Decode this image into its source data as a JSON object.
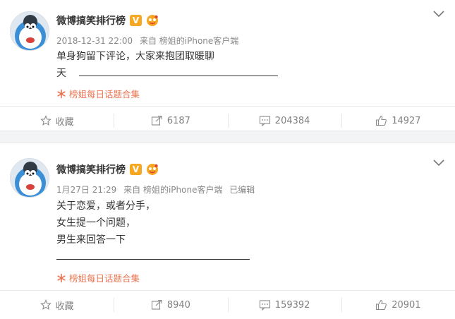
{
  "posts": [
    {
      "author": "微博搞笑排行榜",
      "verified": "V",
      "time": "2018-12-31 22:00",
      "source": "来自 榜姐的iPhone客户端",
      "edited": "",
      "content_lines": [
        "单身狗留下评论，大家来抱团取暖聊",
        "天"
      ],
      "topic": "榜姐每日话题合集",
      "actions": {
        "favorite": "收藏",
        "repost": "6187",
        "comment": "204384",
        "like": "14927"
      }
    },
    {
      "author": "微博搞笑排行榜",
      "verified": "V",
      "time": "1月27日 21:29",
      "source": "来自 榜姐的iPhone客户端",
      "edited": "已编辑",
      "content_lines": [
        "关于恋爱，或者分手，",
        "女生提一个问题，",
        "男生来回答一下"
      ],
      "topic": "榜姐每日话题合集",
      "actions": {
        "favorite": "收藏",
        "repost": "8940",
        "comment": "159392",
        "like": "20901"
      }
    }
  ],
  "colors": {
    "topic": "#eb7350",
    "badge": "#f7a823",
    "meta": "#888888",
    "separator": "#f2f4f5"
  },
  "icons": [
    "avatar",
    "verified-badge-icon",
    "fan-badge-icon",
    "chevron-down-icon",
    "topic-icon",
    "star-icon",
    "repost-icon",
    "comment-icon",
    "like-icon"
  ]
}
